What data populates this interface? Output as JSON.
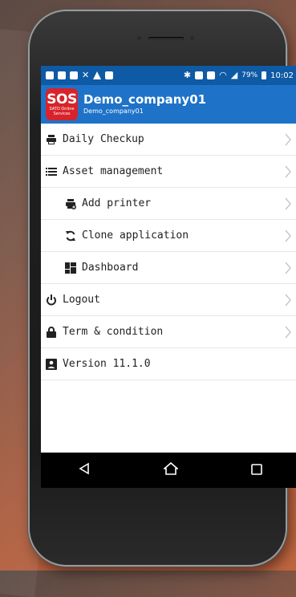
{
  "status_bar": {
    "battery": "79%",
    "time": "10:02"
  },
  "app_bar": {
    "logo_main": "SOS",
    "logo_sub": "SATO Online Services",
    "title": "Demo_company01",
    "subtitle": "Demo_company01"
  },
  "menu": {
    "items": [
      {
        "label": "Daily Checkup",
        "icon": "printer-icon",
        "chevron": true
      },
      {
        "label": "Asset management",
        "icon": "list-icon",
        "chevron": true
      },
      {
        "label": "Add printer",
        "icon": "add-printer-icon",
        "chevron": true
      },
      {
        "label": "Clone application",
        "icon": "sync-icon",
        "chevron": true
      },
      {
        "label": "Dashboard",
        "icon": "dashboard-icon",
        "chevron": true
      },
      {
        "label": "Logout",
        "icon": "power-icon",
        "chevron": true
      },
      {
        "label": "Term & condition",
        "icon": "lock-icon",
        "chevron": true
      },
      {
        "label": "Version 11.1.0",
        "icon": "account-box-icon",
        "chevron": false
      }
    ]
  },
  "colors": {
    "status_bar": "#0f5aa5",
    "app_bar": "#1e73c8",
    "logo": "#d8232a"
  }
}
